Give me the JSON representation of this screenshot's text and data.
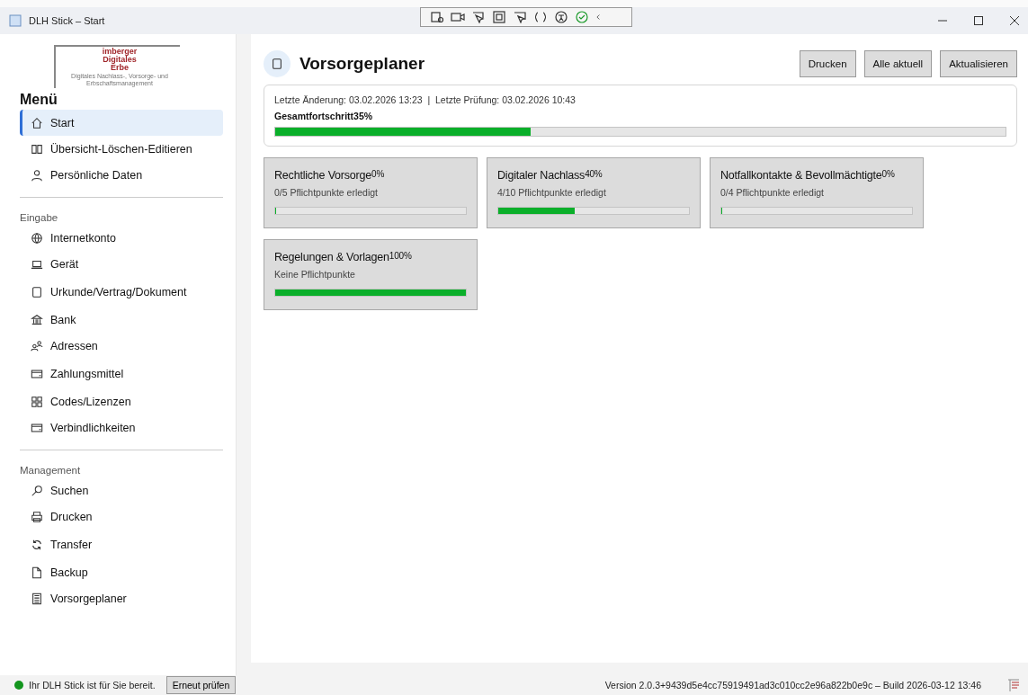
{
  "window": {
    "title": "DLH Stick – Start"
  },
  "logo": {
    "lines": [
      "imberger",
      "Digitales",
      "Erbe"
    ],
    "tagline": "Digitales Nachlass-, Vorsorge- und Erbschaftsmanagement"
  },
  "sidebar": {
    "heading": "Menü",
    "sections": [
      {
        "items": [
          {
            "label": "Start",
            "selected": true
          },
          {
            "label": "Übersicht-Löschen-Editieren",
            "selected": false
          },
          {
            "label": "Persönliche Daten",
            "selected": false
          }
        ]
      },
      {
        "title": "Eingabe",
        "items": [
          {
            "label": "Internetkonto",
            "selected": false
          },
          {
            "label": "Gerät",
            "selected": false
          },
          {
            "label": "Urkunde/Vertrag/Dokument",
            "selected": false
          },
          {
            "label": "Bank",
            "selected": false
          },
          {
            "label": "Adressen",
            "selected": false
          },
          {
            "label": "Zahlungsmittel",
            "selected": false
          },
          {
            "label": "Codes/Lizenzen",
            "selected": false
          },
          {
            "label": "Verbindlichkeiten",
            "selected": false
          }
        ]
      },
      {
        "title": "Management",
        "items": [
          {
            "label": "Suchen",
            "selected": false
          },
          {
            "label": "Drucken",
            "selected": false
          },
          {
            "label": "Transfer",
            "selected": false
          },
          {
            "label": "Backup",
            "selected": false
          },
          {
            "label": "Vorsorgeplaner",
            "selected": false
          }
        ]
      }
    ]
  },
  "page": {
    "title": "Vorsorgeplaner",
    "buttons": [
      "Drucken",
      "Alle aktuell",
      "Aktualisieren"
    ],
    "summary": {
      "info": "Letzte Änderung: 03.02.2026 13:23  |  Letzte Prüfung: 03.02.2026 10:43",
      "label": "Gesamtfortschritt",
      "percent": "35%",
      "level": 0.35
    },
    "cards": [
      {
        "title": "Rechtliche Vorsorge",
        "percent": "0%",
        "subtitle": "0/5 Pflichtpunkte erledigt",
        "level": 0
      },
      {
        "title": "Digitaler Nachlass",
        "percent": "40%",
        "subtitle": "4/10 Pflichtpunkte erledigt",
        "level": 0.4
      },
      {
        "title": "Notfallkontakte & Bevollmächtigte",
        "percent": "0%",
        "subtitle": "0/4 Pflichtpunkte erledigt",
        "level": 0
      },
      {
        "title": "Regelungen & Vorlagen",
        "percent": "100%",
        "subtitle": "Keine Pflichtpunkte",
        "level": 1
      }
    ]
  },
  "status_bar": {
    "message": "Ihr DLH Stick ist für Sie bereit.",
    "button": "Erneut prüfen",
    "version": "Version 2.0.3+9439d5e4cc75919491ad3c010cc2e96a822b0e9c – Build 2026-03-12 13:46"
  }
}
